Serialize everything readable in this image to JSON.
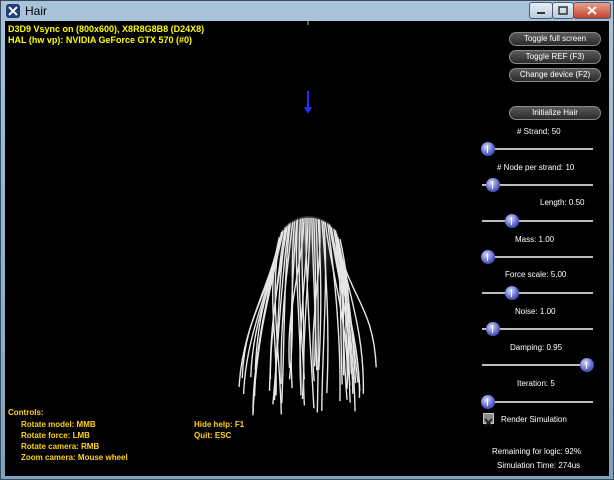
{
  "window": {
    "title": "Hair"
  },
  "stats": {
    "line1": "D3D9 Vsync on (800x600), X8R8G8B8 (D24X8)",
    "line2": "HAL (hw vp): NVIDIA GeForce GTX 570 (#0)"
  },
  "buttons": {
    "toggle_full_screen": "Toggle full screen",
    "toggle_ref": "Toggle REF (F3)",
    "change_device": "Change device (F2)",
    "initialize_hair": "Initialize Hair"
  },
  "sliders": [
    {
      "label": "# Strand: 50",
      "position": 0.05
    },
    {
      "label": "# Node per strand: 10",
      "position": 0.1
    },
    {
      "label": "Length: 0.50",
      "position": 0.27
    },
    {
      "label": "Mass: 1.00",
      "position": 0.05
    },
    {
      "label": "Force scale: 5.00",
      "position": 0.27
    },
    {
      "label": "Noise: 1.00",
      "position": 0.1
    },
    {
      "label": "Damping: 0.95",
      "position": 0.95
    },
    {
      "label": "Iteration: 5",
      "position": 0.05
    }
  ],
  "render_simulation": {
    "label": "Render Simulation",
    "checked": true
  },
  "perf": {
    "remaining": "Remaining for logic: 92%",
    "sim_time": "Simulation Time: 274us"
  },
  "help": {
    "heading": "Controls:",
    "col1": [
      "Rotate model: MMB",
      "Rotate force: LMB",
      "Rotate camera: RMB",
      "Zoom camera: Mouse wheel"
    ],
    "col2": [
      "Hide help: F1",
      "Quit: ESC"
    ]
  },
  "colors": {
    "stats_text": "#ffff00",
    "help_text": "#ffd21f",
    "force_arrow": "#2a2aff",
    "hair": "#e6e6e6"
  },
  "icons": {
    "app": "app-icon",
    "minimize": "minimize-icon",
    "maximize": "maximize-icon",
    "close": "close-icon"
  }
}
